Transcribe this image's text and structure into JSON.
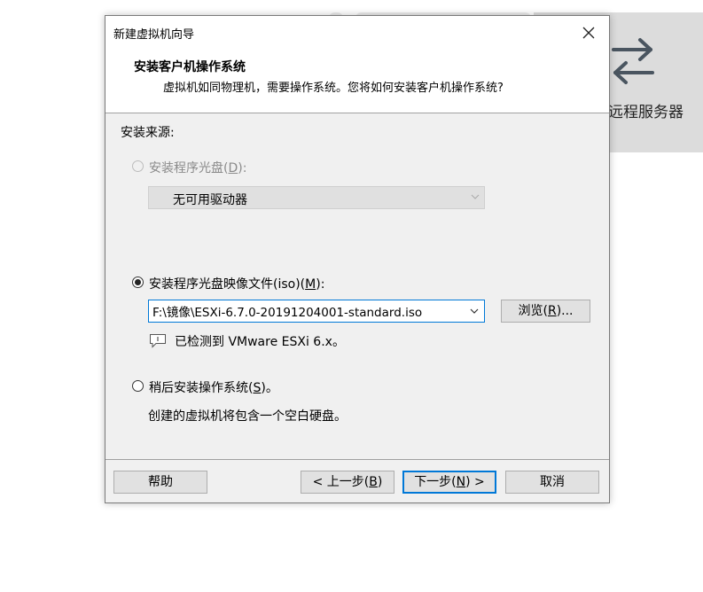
{
  "background": {
    "card_label": "远程服务器",
    "card_icon": "swap-arrows-icon"
  },
  "dialog": {
    "title": "新建虚拟机向导",
    "header_title": "安装客户机操作系统",
    "header_subtitle": "虚拟机如同物理机，需要操作系统。您将如何安装客户机操作系统?",
    "source_label": "安装来源:",
    "option_disc": {
      "label": "安装程序光盘(",
      "key": "D",
      "suffix": "):",
      "selected": false,
      "enabled": false
    },
    "disc_combo_value": "无可用驱动器",
    "option_iso": {
      "label": "安装程序光盘映像文件(iso)(",
      "key": "M",
      "suffix": "):",
      "selected": true
    },
    "iso_path": "F:\\镜像\\ESXi-6.7.0-20191204001-standard.iso",
    "browse_button": {
      "label": "浏览(",
      "key": "R",
      "suffix": ")..."
    },
    "detect_text": "已检测到 VMware ESXi 6.x。",
    "option_later": {
      "label": "稍后安装操作系统(",
      "key": "S",
      "suffix": ")。",
      "selected": false
    },
    "later_desc": "创建的虚拟机将包含一个空白硬盘。",
    "buttons": {
      "help": "帮助",
      "back": {
        "label": "< 上一步(",
        "key": "B",
        "suffix": ")"
      },
      "next": {
        "label": "下一步(",
        "key": "N",
        "suffix": ") >"
      },
      "cancel": "取消"
    }
  }
}
